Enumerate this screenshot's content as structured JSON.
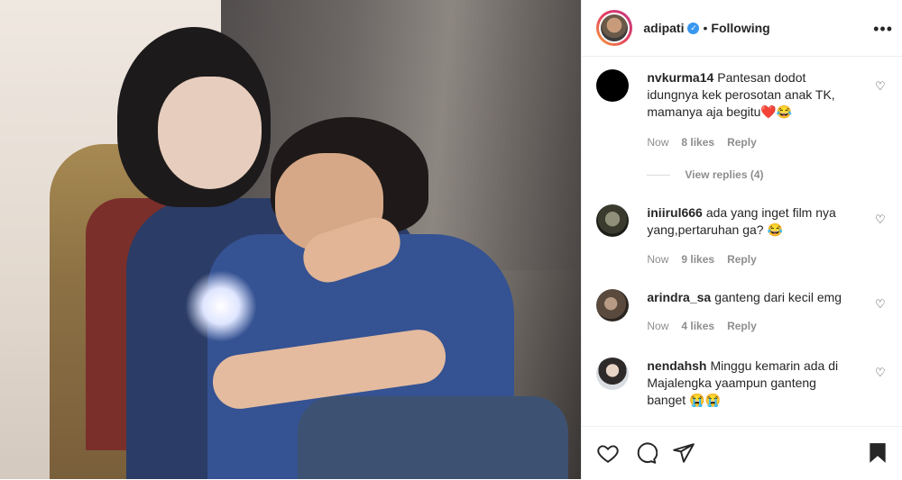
{
  "post": {
    "username": "adipati",
    "verified": true,
    "follow_status": "Following",
    "separator": "•"
  },
  "comments": [
    {
      "username": "nvkurma14",
      "text": "Pantesan dodot idungnya kek perosotan anak TK, mamanya aja begitu❤️😂",
      "time": "Now",
      "likes": "8 likes",
      "reply": "Reply",
      "view_replies": "View replies (4)"
    },
    {
      "username": "iniirul666",
      "text": "ada yang inget film nya yang,pertaruhan ga? 😂",
      "time": "Now",
      "likes": "9 likes",
      "reply": "Reply"
    },
    {
      "username": "arindra_sa",
      "text": "ganteng dari kecil emg",
      "time": "Now",
      "likes": "4 likes",
      "reply": "Reply"
    },
    {
      "username": "nendahsh",
      "text": "Minggu kemarin ada di Majalengka yaampun ganteng banget 😭😭",
      "time": "",
      "likes": "",
      "reply": ""
    }
  ],
  "icons": {
    "more": "more-icon",
    "like": "heart-icon",
    "comment": "comment-icon",
    "share": "share-icon",
    "save": "bookmark-icon"
  },
  "colors": {
    "verified": "#3897f0",
    "muted": "#8e8e8e",
    "text": "#262626",
    "heart_emoji": "#c0392b"
  }
}
